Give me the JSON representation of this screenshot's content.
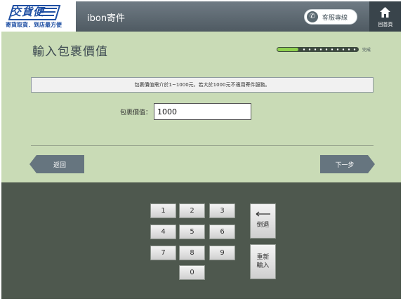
{
  "header": {
    "logo_text": "交貨便",
    "logo_sub": "寄貨取貨．到店最方便",
    "app_title": "ibon寄件",
    "customer_service_label": "客服專線",
    "home_label": "回首頁"
  },
  "main": {
    "title": "輸入包裹價值",
    "progress_label": "完成",
    "notice": "包裹價值需介於1~1000元，若大於1000元不適用寄件服務。",
    "field_label": "包裹價值：",
    "field_value": "1000",
    "back_label": "返回",
    "next_label": "下一步"
  },
  "keypad": {
    "keys": [
      "1",
      "2",
      "3",
      "4",
      "5",
      "6",
      "7",
      "8",
      "9",
      "0"
    ],
    "backspace_label": "倒退",
    "reset_line1": "重新",
    "reset_line2": "輸入"
  }
}
